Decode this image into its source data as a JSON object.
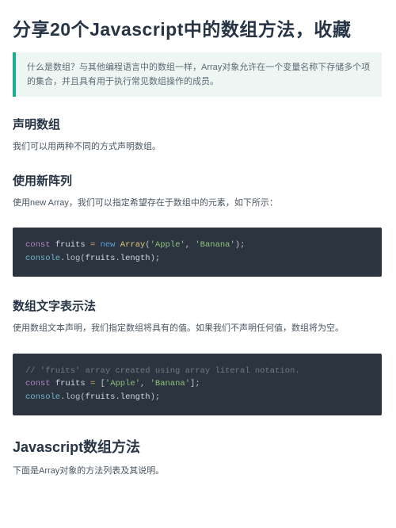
{
  "title": "分享20个Javascript中的数组方法，收藏",
  "callout": "什么是数组？与其他编程语言中的数组一样，Array对象允许在一个变量名称下存储多个项的集合，并且具有用于执行常见数组操作的成员。",
  "s1": {
    "heading": "声明数组",
    "text": "我们可以用两种不同的方式声明数组。"
  },
  "s2": {
    "heading": "使用新阵列",
    "text": "使用new Array，我们可以指定希望存在于数组中的元素，如下所示："
  },
  "code1": {
    "kw_const": "const",
    "var1": "fruits",
    "eq": "=",
    "kw_new": "new",
    "cls": "Array",
    "lp": "(",
    "str1": "'Apple'",
    "comma": ",",
    "str2": "'Banana'",
    "rp": ")",
    "semi": ";",
    "obj_console": "console",
    "dot": ".",
    "mth_log": "log",
    "prop_length": "length"
  },
  "s3": {
    "heading": "数组文字表示法",
    "text": "使用数组文本声明，我们指定数组将具有的值。如果我们不声明任何值，数组将为空。"
  },
  "code2": {
    "cmt": "// 'fruits' array created using array literal notation.",
    "kw_const": "const",
    "var1": "fruits",
    "eq": "=",
    "lb": "[",
    "str1": "'Apple'",
    "comma": ",",
    "str2": "'Banana'",
    "rb": "]",
    "semi": ";",
    "obj_console": "console",
    "dot": ".",
    "mth_log": "log",
    "lp": "(",
    "rp": ")",
    "prop_length": "length"
  },
  "s4": {
    "heading": "Javascript数组方法",
    "text": "下面是Array对象的方法列表及其说明。"
  }
}
